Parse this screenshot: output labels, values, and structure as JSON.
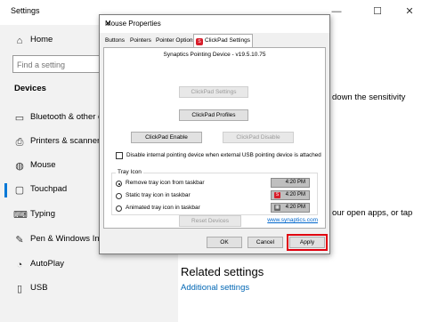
{
  "settings": {
    "title": "Settings",
    "controls": {
      "minimize": "—",
      "maximize": "☐",
      "close": "✕"
    },
    "sidebar": {
      "home": {
        "icon": "home-icon",
        "label": "Home"
      },
      "search_placeholder": "Find a setting",
      "section": "Devices",
      "items": [
        {
          "icon": "bluetooth-icon",
          "label": "Bluetooth & other de"
        },
        {
          "icon": "printer-icon",
          "label": "Printers & scanners"
        },
        {
          "icon": "mouse-icon",
          "label": "Mouse"
        },
        {
          "icon": "touchpad-icon",
          "label": "Touchpad",
          "active": true
        },
        {
          "icon": "keyboard-icon",
          "label": "Typing"
        },
        {
          "icon": "pen-icon",
          "label": "Pen & Windows Ink"
        },
        {
          "icon": "autoplay-icon",
          "label": "AutoPlay"
        },
        {
          "icon": "usb-icon",
          "label": "USB"
        }
      ]
    },
    "main": {
      "sensitivity_fragment": "down the sensitivity",
      "apps_fragment": "our open apps, or tap",
      "related_heading": "Related settings",
      "related_link": "Additional settings"
    }
  },
  "dialog": {
    "title": "Mouse Properties",
    "close": "✕",
    "tabs": [
      "Buttons",
      "Pointers",
      "Pointer Options",
      "ClickPad Settings"
    ],
    "selected_tab": "ClickPad Settings",
    "device_name": "Synaptics Pointing Device - v19.5.10.75",
    "buttons": {
      "clickpad_settings": "ClickPad Settings",
      "clickpad_profiles": "ClickPad Profiles",
      "clickpad_enable": "ClickPad Enable",
      "clickpad_disable": "ClickPad Disable",
      "reset_devices": "Reset Devices"
    },
    "disable_checkbox": "Disable internal pointing device when external USB pointing device is attached",
    "tray_group": "Tray Icon",
    "tray_options": [
      {
        "label": "Remove tray icon from taskbar",
        "selected": true,
        "time": "4:20 PM",
        "icon": ""
      },
      {
        "label": "Static tray icon in taskbar",
        "selected": false,
        "time": "4:20 PM",
        "icon": "synaptics-tray-icon"
      },
      {
        "label": "Animated tray icon in taskbar",
        "selected": false,
        "time": "4:20 PM",
        "icon": "animated-tray-icon"
      }
    ],
    "link": "www.synaptics.com",
    "footer": {
      "ok": "OK",
      "cancel": "Cancel",
      "apply": "Apply"
    },
    "highlight_color": "#e0000f"
  }
}
